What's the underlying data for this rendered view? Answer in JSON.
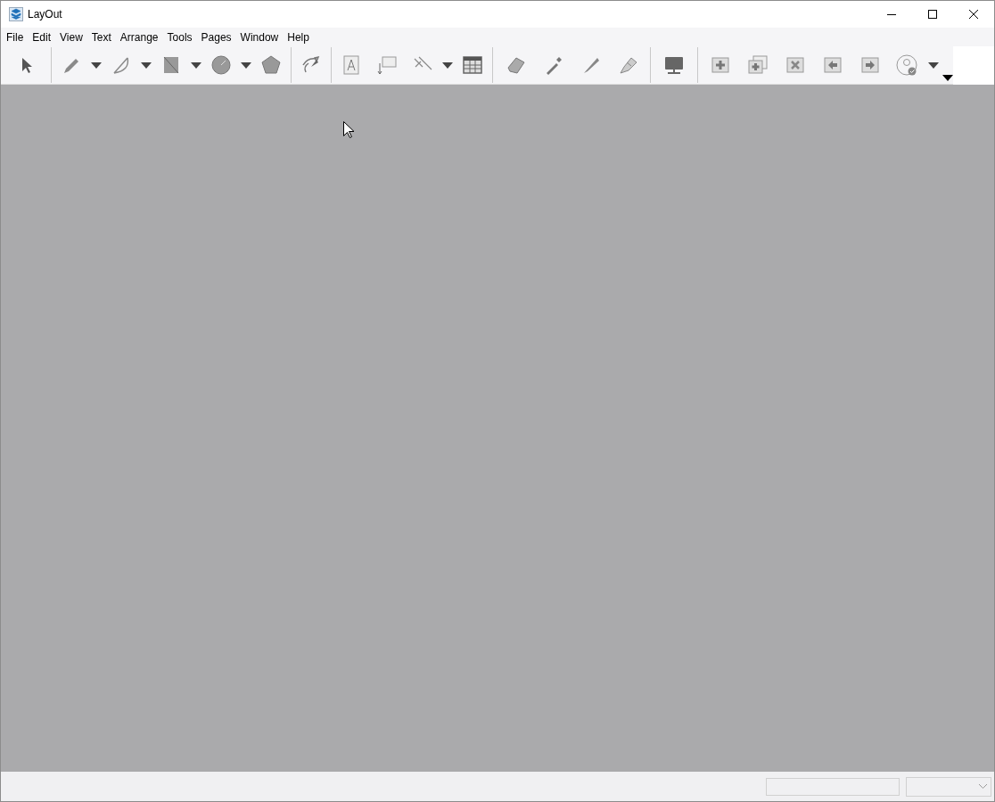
{
  "window": {
    "title": "LayOut"
  },
  "menu": [
    "File",
    "Edit",
    "View",
    "Text",
    "Arrange",
    "Tools",
    "Pages",
    "Window",
    "Help"
  ]
}
